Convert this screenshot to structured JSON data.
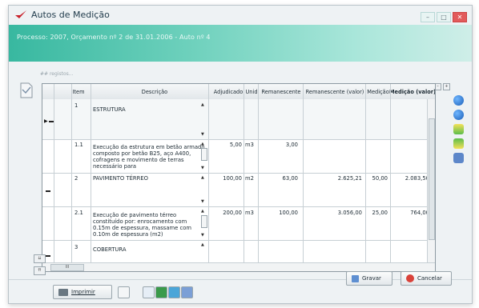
{
  "window": {
    "title": "Autos de Medição",
    "header": "Processo: 2007, Orçamento nº 2 de 31.01.2006 - Auto nº 4",
    "controls": [
      "minimize-icon",
      "maximize-icon",
      "close-icon"
    ]
  },
  "records_label": "## registos...",
  "grid": {
    "columns": [
      "Item",
      "Descrição",
      "Adjudicado",
      "Unid",
      "Remanescente",
      "Remanescente (valor)",
      "Medição",
      "Medição (valor)"
    ],
    "rows": [
      {
        "item": "1",
        "descricao": "ESTRUTURA",
        "adjudicado": "",
        "unid": "",
        "remanescente": "",
        "remanescente_valor": "",
        "medicao": "",
        "medicao_valor": ""
      },
      {
        "item": "1.1",
        "descricao": "Execução da estrutura em betão armado composto por betão B25, aço A400, cofragens e movimento de terras necessário para",
        "adjudicado": "5,00",
        "unid": "m3",
        "remanescente": "3,00",
        "remanescente_valor": "",
        "medicao": "",
        "medicao_valor": ""
      },
      {
        "item": "2",
        "descricao": "PAVIMENTO TÉRREO",
        "adjudicado": "100,00",
        "unid": "m2",
        "remanescente": "63,00",
        "remanescente_valor": "2.625,21",
        "medicao": "50,00",
        "medicao_valor": "2.083,50"
      },
      {
        "item": "2.1",
        "descricao": "Execução de pavimento térreo constituído por: enrocamento com 0.15m de espessura, massame com 0.10m de espessura (m2)",
        "adjudicado": "200,00",
        "unid": "m3",
        "remanescente": "100,00",
        "remanescente_valor": "3.056,00",
        "medicao": "25,00",
        "medicao_valor": "764,00"
      },
      {
        "item": "3",
        "descricao": "COBERTURA",
        "adjudicado": "",
        "unid": "",
        "remanescente": "",
        "remanescente_valor": "",
        "medicao": "",
        "medicao_valor": ""
      }
    ]
  },
  "buttons": {
    "print": "Imprimir",
    "save": "Gravar",
    "cancel": "Cancelar"
  },
  "scroll_thumb": "III"
}
